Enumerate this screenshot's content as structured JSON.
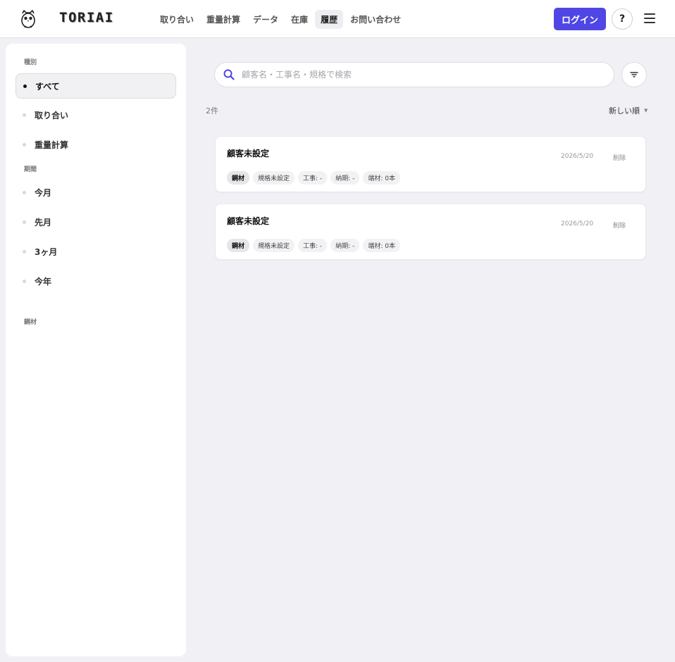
{
  "header": {
    "brand": "TORIAI",
    "nav": [
      {
        "label": "取り合い"
      },
      {
        "label": "重量計算"
      },
      {
        "label": "データ"
      },
      {
        "label": "在庫"
      },
      {
        "label": "履歴"
      },
      {
        "label": "お問い合わせ"
      }
    ],
    "active_nav": "履歴",
    "login_label": "ログイン",
    "help_label": "?"
  },
  "sidebar": {
    "type_heading": "種別",
    "type_items": [
      {
        "label": "すべて",
        "active": true
      },
      {
        "label": "取り合い",
        "active": false
      },
      {
        "label": "重量計算",
        "active": false
      }
    ],
    "period_heading": "期間",
    "period_items": [
      {
        "label": "今月"
      },
      {
        "label": "先月"
      },
      {
        "label": "3ヶ月"
      },
      {
        "label": "今年"
      }
    ],
    "material_heading": "鋼材"
  },
  "search": {
    "placeholder": "顧客名・工事名・規格で検索",
    "value": ""
  },
  "results": {
    "count": "2件",
    "sort_label": "新しい順"
  },
  "records": [
    {
      "title": "顧客未設定",
      "date": "2026/5/20",
      "delete_label": "削除",
      "tags": [
        "鋼材",
        "規格未設定",
        "工事: -",
        "納期: -",
        "端材: 0本"
      ]
    },
    {
      "title": "顧客未設定",
      "date": "2026/5/20",
      "delete_label": "削除",
      "tags": [
        "鋼材",
        "規格未設定",
        "工事: -",
        "納期: -",
        "端材: 0本"
      ]
    }
  ],
  "colors": {
    "accent": "#4f46e5",
    "background": "#f1f1f5"
  },
  "icons": {
    "logo": "owl-icon",
    "search": "search-icon",
    "filter": "filter-icon",
    "menu": "hamburger-menu-icon",
    "sort": "chevron-down-icon"
  }
}
